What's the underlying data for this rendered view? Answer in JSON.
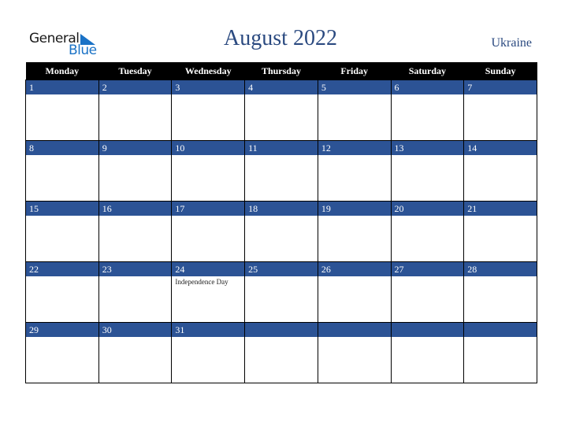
{
  "logo": {
    "word1": "General",
    "word2": "Blue"
  },
  "title": "August 2022",
  "country": "Ukraine",
  "colors": {
    "header_bg": "#000000",
    "band": "#2c5395",
    "title": "#2b4a80",
    "logo_blue": "#1a72c6"
  },
  "weekdays": [
    "Monday",
    "Tuesday",
    "Wednesday",
    "Thursday",
    "Friday",
    "Saturday",
    "Sunday"
  ],
  "weeks": [
    [
      {
        "day": "1",
        "event": ""
      },
      {
        "day": "2",
        "event": ""
      },
      {
        "day": "3",
        "event": ""
      },
      {
        "day": "4",
        "event": ""
      },
      {
        "day": "5",
        "event": ""
      },
      {
        "day": "6",
        "event": ""
      },
      {
        "day": "7",
        "event": ""
      }
    ],
    [
      {
        "day": "8",
        "event": ""
      },
      {
        "day": "9",
        "event": ""
      },
      {
        "day": "10",
        "event": ""
      },
      {
        "day": "11",
        "event": ""
      },
      {
        "day": "12",
        "event": ""
      },
      {
        "day": "13",
        "event": ""
      },
      {
        "day": "14",
        "event": ""
      }
    ],
    [
      {
        "day": "15",
        "event": ""
      },
      {
        "day": "16",
        "event": ""
      },
      {
        "day": "17",
        "event": ""
      },
      {
        "day": "18",
        "event": ""
      },
      {
        "day": "19",
        "event": ""
      },
      {
        "day": "20",
        "event": ""
      },
      {
        "day": "21",
        "event": ""
      }
    ],
    [
      {
        "day": "22",
        "event": ""
      },
      {
        "day": "23",
        "event": ""
      },
      {
        "day": "24",
        "event": "Independence Day"
      },
      {
        "day": "25",
        "event": ""
      },
      {
        "day": "26",
        "event": ""
      },
      {
        "day": "27",
        "event": ""
      },
      {
        "day": "28",
        "event": ""
      }
    ],
    [
      {
        "day": "29",
        "event": ""
      },
      {
        "day": "30",
        "event": ""
      },
      {
        "day": "31",
        "event": ""
      },
      {
        "day": "",
        "event": ""
      },
      {
        "day": "",
        "event": ""
      },
      {
        "day": "",
        "event": ""
      },
      {
        "day": "",
        "event": ""
      }
    ]
  ]
}
